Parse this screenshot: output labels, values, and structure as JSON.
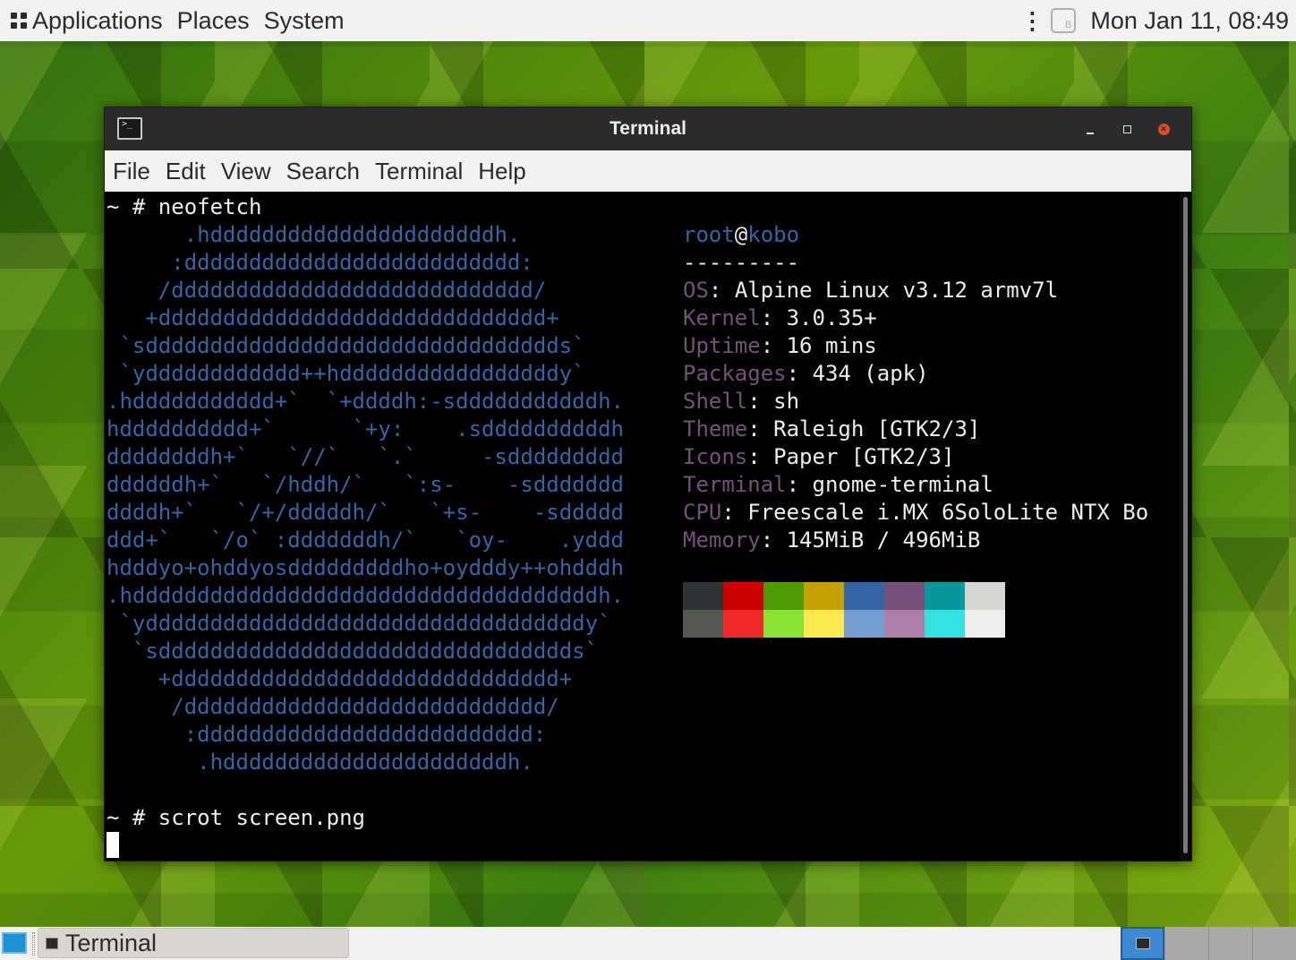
{
  "top_panel": {
    "menus": [
      "Applications",
      "Places",
      "System"
    ],
    "clock": "Mon Jan 11, 08:49"
  },
  "window": {
    "title": "Terminal",
    "menu": [
      "File",
      "Edit",
      "View",
      "Search",
      "Terminal",
      "Help"
    ]
  },
  "terminal": {
    "prompt1": "~ # neofetch",
    "logo": [
      "      .hddddddddddddddddddddddh.",
      "     :dddddddddddddddddddddddddd:",
      "    /dddddddddddddddddddddddddddd/",
      "   +dddddddddddddddddddddddddddddd+",
      " `sdddddddddddddddddddddddddddddddds`",
      " `ydddddddddddd++hdddddddddddddddddy`",
      ".hddddddddddd+`  `+ddddh:-sdddddddddddh.",
      "hdddddddddd+`      `+y:    .sddddddddddh",
      "ddddddddh+`   `//`   `.`     -sddddddddd",
      "ddddddh+`   `/hddh/`   `:s-    -sddddddd",
      "ddddh+`   `/+/dddddh/`   `+s-    -sddddd",
      "ddd+`   `/o` :dddddddh/`   `oy-    .yddd",
      "hdddyo+ohddyosdddddddddho+oydddy++ohdddh",
      ".hddddddddddddddddddddddddddddddddddddh.",
      " `yddddddddddddddddddddddddddddddddddy`",
      "  `sdddddddddddddddddddddddddddddddds`",
      "    +dddddddddddddddddddddddddddddd+",
      "     /dddddddddddddddddddddddddddd/",
      "      :dddddddddddddddddddddddddd:",
      "       .hddddddddddddddddddddddh."
    ],
    "user": "root",
    "at": "@",
    "host": "kobo",
    "separator": "---------",
    "info": [
      {
        "key": "OS",
        "value": "Alpine Linux v3.12 armv7l"
      },
      {
        "key": "Kernel",
        "value": "3.0.35+"
      },
      {
        "key": "Uptime",
        "value": "16 mins"
      },
      {
        "key": "Packages",
        "value": "434 (apk)"
      },
      {
        "key": "Shell",
        "value": "sh"
      },
      {
        "key": "Theme",
        "value": "Raleigh [GTK2/3]"
      },
      {
        "key": "Icons",
        "value": "Paper [GTK2/3]"
      },
      {
        "key": "Terminal",
        "value": "gnome-terminal"
      },
      {
        "key": "CPU",
        "value": "Freescale i.MX 6SoloLite NTX Bo"
      },
      {
        "key": "Memory",
        "value": "145MiB / 496MiB"
      }
    ],
    "colon": ": ",
    "palette": [
      "#2e3436",
      "#cc0000",
      "#4e9a06",
      "#c4a000",
      "#3465a4",
      "#75507b",
      "#06989a",
      "#d3d7cf",
      "#555753",
      "#ef2929",
      "#8ae234",
      "#fce94f",
      "#729fcf",
      "#ad7fa8",
      "#34e2e2",
      "#eeeeec"
    ],
    "prompt2": "~ # scrot screen.png"
  },
  "bottom_panel": {
    "task_label": "Terminal"
  }
}
